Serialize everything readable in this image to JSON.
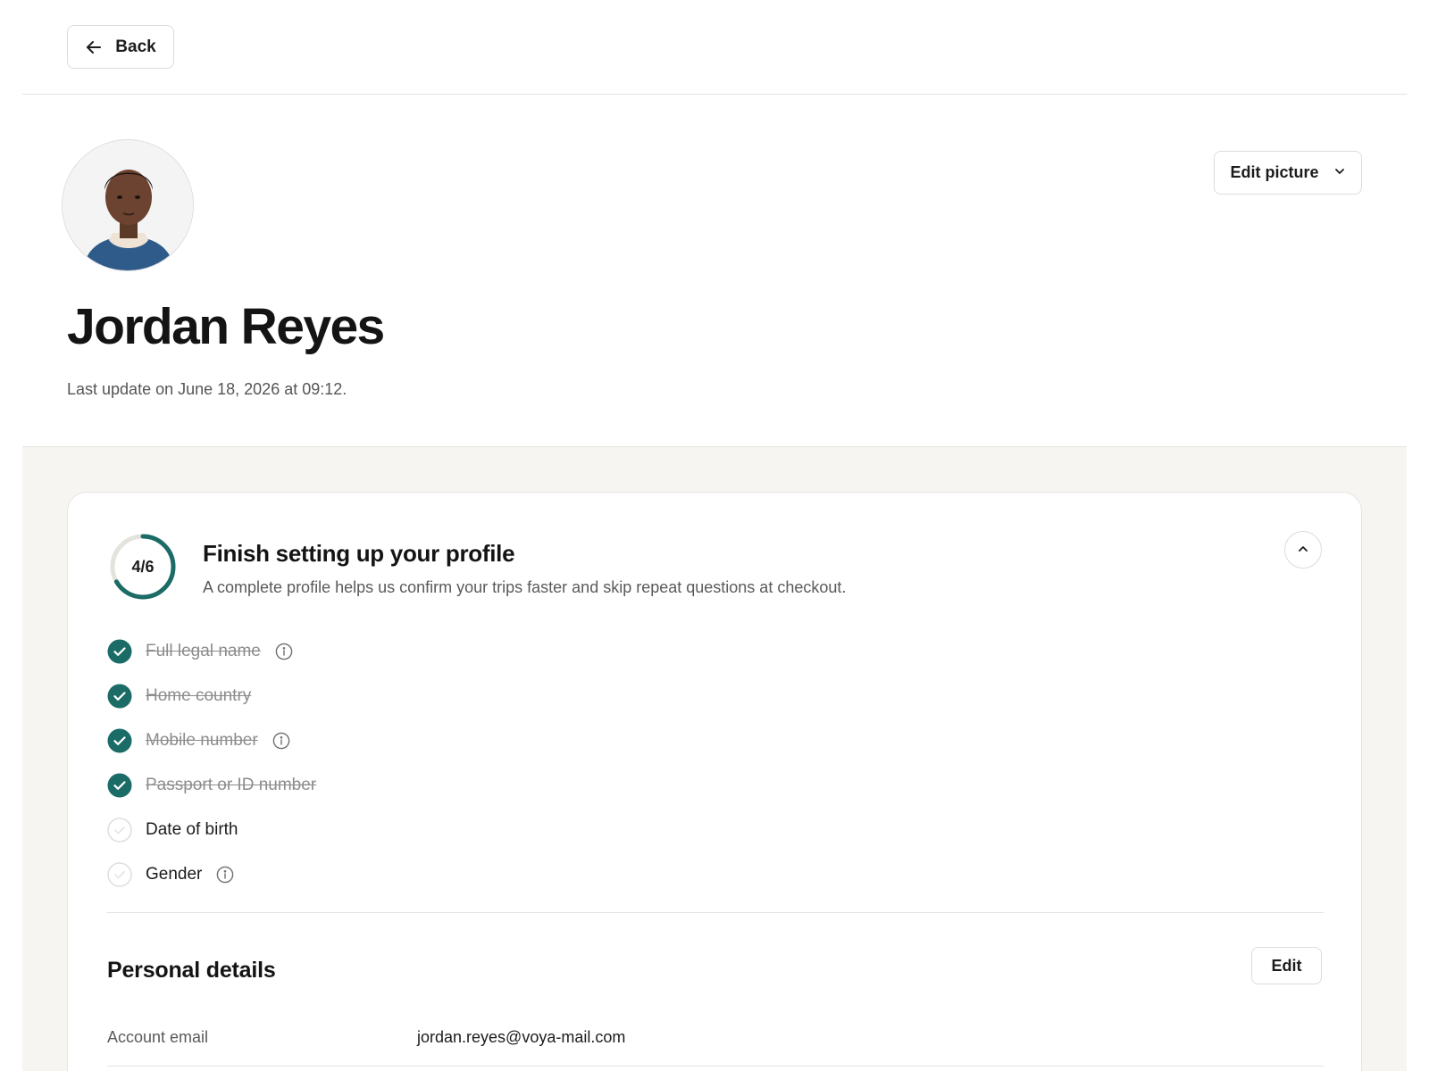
{
  "toolbar": {
    "back_label": "Back"
  },
  "profile": {
    "name": "Jordan Reyes",
    "last_update": "Last update on June 18, 2026 at 09:12.",
    "edit_picture_label": "Edit picture"
  },
  "setup": {
    "title": "Finish setting up your profile",
    "description": "A complete profile helps us confirm your trips faster and skip repeat questions at checkout.",
    "progress_label": "4/6",
    "completed": 4,
    "total": 6,
    "items": [
      {
        "label": "Full legal name",
        "done": true,
        "info": true
      },
      {
        "label": "Home country",
        "done": true,
        "info": false
      },
      {
        "label": "Mobile number",
        "done": true,
        "info": true
      },
      {
        "label": "Passport or ID number",
        "done": true,
        "info": false
      },
      {
        "label": "Date of birth",
        "done": false,
        "info": false
      },
      {
        "label": "Gender",
        "done": false,
        "info": true
      }
    ]
  },
  "personal_details": {
    "title": "Personal details",
    "edit_label": "Edit",
    "fields": [
      {
        "label": "Account email",
        "value": "jordan.reyes@voya-mail.com"
      }
    ]
  },
  "colors": {
    "accent": "#1b6b66",
    "ring_track": "#e4e2dc",
    "content_bg": "#f6f5f2"
  }
}
